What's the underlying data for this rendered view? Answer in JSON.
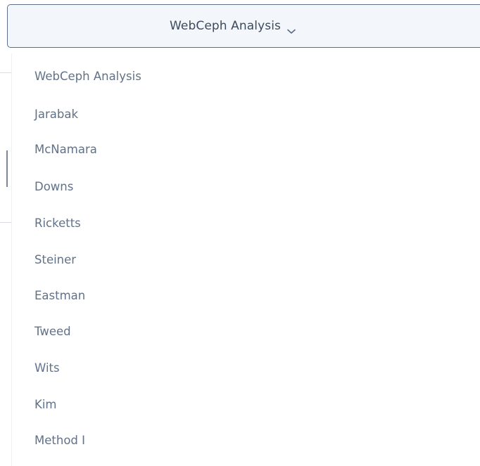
{
  "select": {
    "label": "WebCeph Analysis",
    "chevron_icon": "chevron-down-icon"
  },
  "menu": {
    "items": [
      {
        "label": "WebCeph Analysis"
      },
      {
        "label": "Jarabak"
      },
      {
        "label": "McNamara"
      },
      {
        "label": "Downs"
      },
      {
        "label": "Ricketts"
      },
      {
        "label": "Steiner"
      },
      {
        "label": "Eastman"
      },
      {
        "label": "Tweed"
      },
      {
        "label": "Wits"
      },
      {
        "label": "Kim"
      },
      {
        "label": "Method I"
      }
    ]
  },
  "colors": {
    "text": "#617288",
    "button_text": "#3d4a5c",
    "button_border": "#5b6f8a",
    "button_bg": "#f3f7fc"
  }
}
